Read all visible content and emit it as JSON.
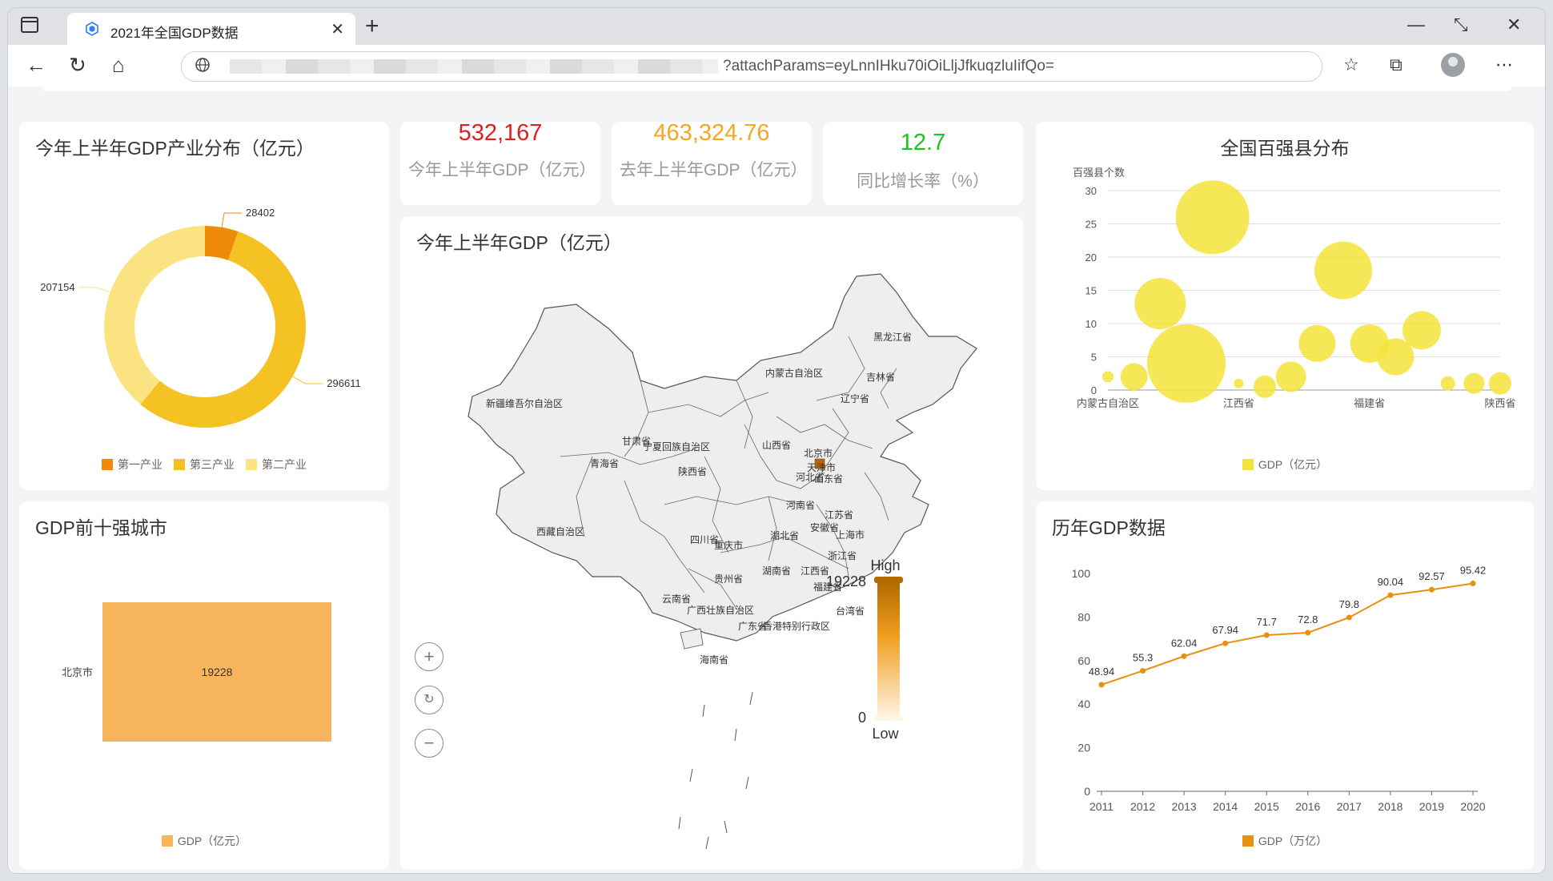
{
  "browser": {
    "tab_title": "2021年全国GDP数据",
    "url_visible": "?attachParams=eyLnnIHku70iOiLljJfkuqzluIifQo="
  },
  "kpis": [
    {
      "value": "532,167",
      "label": "今年上半年GDP（亿元）",
      "color": "#e02020"
    },
    {
      "value": "463,324.76",
      "label": "去年上半年GDP（亿元）",
      "color": "#f5a623"
    },
    {
      "value": "12.7",
      "label": "同比增长率（%）",
      "color": "#1ec31e"
    }
  ],
  "donut": {
    "title": "今年上半年GDP产业分布（亿元）",
    "chart_data": {
      "type": "pie",
      "categories": [
        "第一产业",
        "第三产业",
        "第二产业"
      ],
      "values": [
        28402,
        296611,
        207154
      ],
      "colors": [
        "#ef8b09",
        "#f5c223",
        "#fae380"
      ]
    }
  },
  "top_cities": {
    "title": "GDP前十强城市",
    "legend": "GDP（亿元）",
    "chart_data": {
      "type": "bar",
      "categories": [
        "北京市"
      ],
      "values": [
        19228
      ],
      "color": "#f7b55c"
    }
  },
  "map": {
    "title": "今年上半年GDP（亿元）",
    "visual_map": {
      "high_label": "High",
      "low_label": "Low",
      "max": "19228",
      "min": "0"
    },
    "province_labels": [
      "黑龙江省",
      "吉林省",
      "辽宁省",
      "内蒙古自治区",
      "新疆维吾尔自治区",
      "北京市",
      "天津市",
      "河北省",
      "山西省",
      "甘肃省",
      "宁夏回族自治区",
      "青海省",
      "陕西省",
      "山东省",
      "河南省",
      "江苏省",
      "安徽省",
      "上海市",
      "西藏自治区",
      "四川省",
      "湖北省",
      "重庆市",
      "浙江省",
      "湖南省",
      "江西省",
      "贵州省",
      "福建省",
      "云南省",
      "广西壮族自治区",
      "广东省",
      "香港特别行政区",
      "台湾省",
      "海南省"
    ],
    "highlight_color": "#b36b00",
    "land_color": "#eeeeee"
  },
  "bubble": {
    "title": "全国百强县分布",
    "ylabel": "百强县个数",
    "legend": "GDP（亿元）",
    "chart_data": {
      "type": "scatter",
      "x_tick_labels": [
        "内蒙古自治区",
        "江西省",
        "福建省",
        "陕西省"
      ],
      "ylim": [
        0,
        30
      ],
      "y_ticks": [
        0,
        5,
        10,
        15,
        20,
        25,
        30
      ],
      "points": [
        {
          "x": 0,
          "y": 2,
          "size": 14
        },
        {
          "x": 1,
          "y": 2,
          "size": 34
        },
        {
          "x": 2,
          "y": 13,
          "size": 64
        },
        {
          "x": 3,
          "y": 4,
          "size": 98
        },
        {
          "x": 4,
          "y": 26,
          "size": 92
        },
        {
          "x": 5,
          "y": 1,
          "size": 12
        },
        {
          "x": 6,
          "y": 0.5,
          "size": 28
        },
        {
          "x": 7,
          "y": 2,
          "size": 38
        },
        {
          "x": 8,
          "y": 7,
          "size": 46
        },
        {
          "x": 9,
          "y": 18,
          "size": 72
        },
        {
          "x": 10,
          "y": 7,
          "size": 48
        },
        {
          "x": 11,
          "y": 5,
          "size": 46
        },
        {
          "x": 12,
          "y": 9,
          "size": 48
        },
        {
          "x": 13,
          "y": 1,
          "size": 18
        },
        {
          "x": 14,
          "y": 1,
          "size": 26
        },
        {
          "x": 15,
          "y": 1,
          "size": 28
        }
      ],
      "color": "#f4e33a"
    }
  },
  "history": {
    "title": "历年GDP数据",
    "legend": "GDP（万亿）",
    "chart_data": {
      "type": "line",
      "x": [
        "2011",
        "2012",
        "2013",
        "2014",
        "2015",
        "2016",
        "2017",
        "2018",
        "2019",
        "2020"
      ],
      "values": [
        48.94,
        55.3,
        62.04,
        67.94,
        71.7,
        72.8,
        79.8,
        90.04,
        92.57,
        95.42
      ],
      "ylim": [
        0,
        100
      ],
      "y_ticks": [
        0,
        20,
        40,
        60,
        80,
        100
      ],
      "color": "#e8900f"
    }
  }
}
